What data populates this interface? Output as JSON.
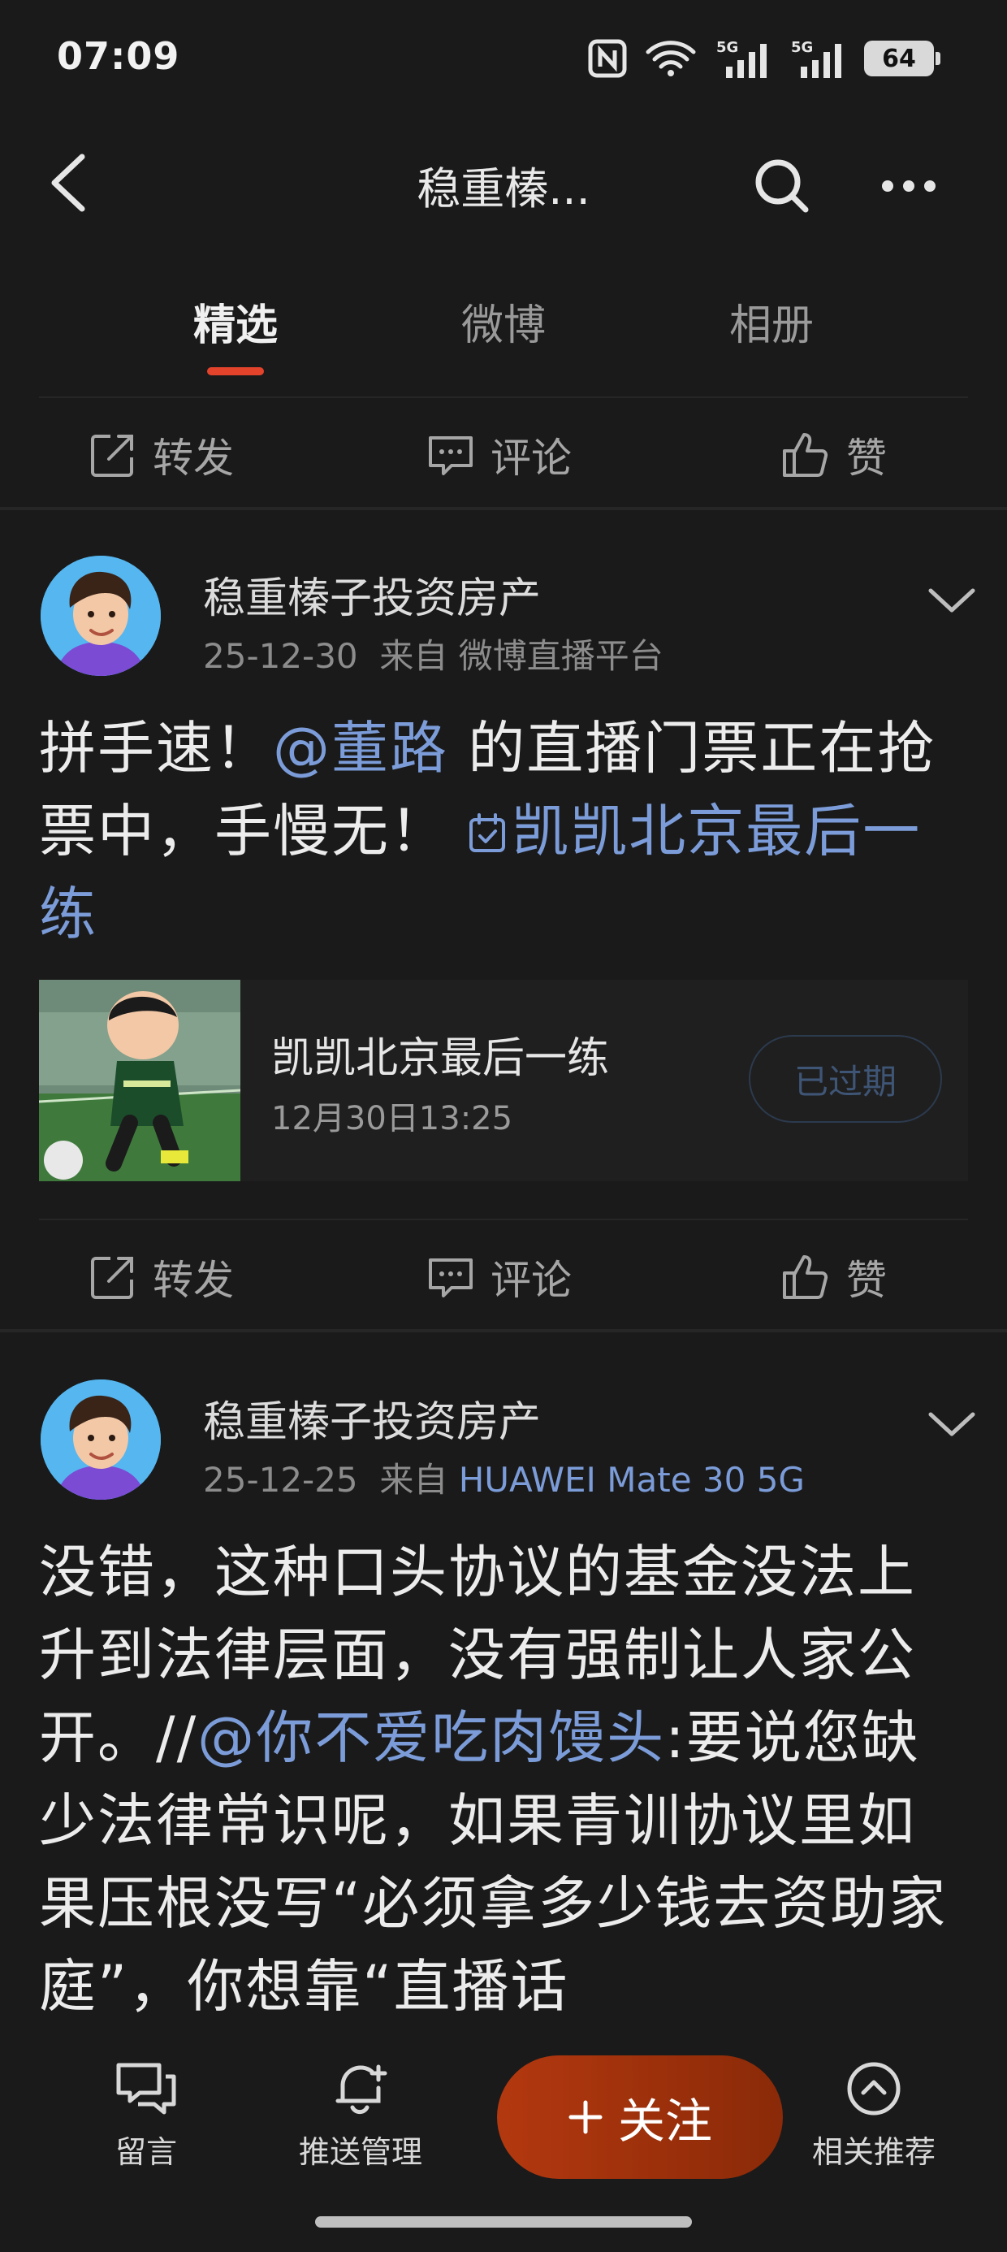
{
  "status_bar": {
    "time": "07:09",
    "battery": "64"
  },
  "header": {
    "title": "稳重榛..."
  },
  "tabs": [
    {
      "label": "精选",
      "active": true
    },
    {
      "label": "微博",
      "active": false
    },
    {
      "label": "相册",
      "active": false
    }
  ],
  "actions": {
    "repost": "转发",
    "comment": "评论",
    "like": "赞"
  },
  "posts": [
    {
      "author": "稳重榛子投资房产",
      "date": "25-12-30",
      "source_prefix": "来自",
      "source": "微博直播平台",
      "text": {
        "part1": "拼手速！",
        "mention": "@董路",
        "part2": " 的直播门票正在抢票中，手慢无！ ",
        "topic": "凯凯北京最后一练"
      },
      "card": {
        "title": "凯凯北京最后一练",
        "time": "12月30日13:25",
        "button": "已过期"
      }
    },
    {
      "author": "稳重榛子投资房产",
      "date": "25-12-25",
      "source_prefix": "来自",
      "source": "HUAWEI Mate 30 5G",
      "text": {
        "part1": "没错，这种口头协议的基金没法上升到法律层面，没有强制让人家公开。//",
        "mention": "@你不爱吃肉馒头",
        "part2": ":要说您缺少法律常识呢，如果青训协议里如果压根没写“必须拿多少钱去资助家庭”，你想靠“直播话"
      }
    }
  ],
  "bottom_nav": {
    "message": "留言",
    "push": "推送管理",
    "follow": "关注",
    "related": "相关推荐"
  },
  "colors": {
    "accent": "#e3432b",
    "link": "#7b9cd8",
    "follow_button": "#b3380f",
    "background": "#1a1a1a"
  }
}
